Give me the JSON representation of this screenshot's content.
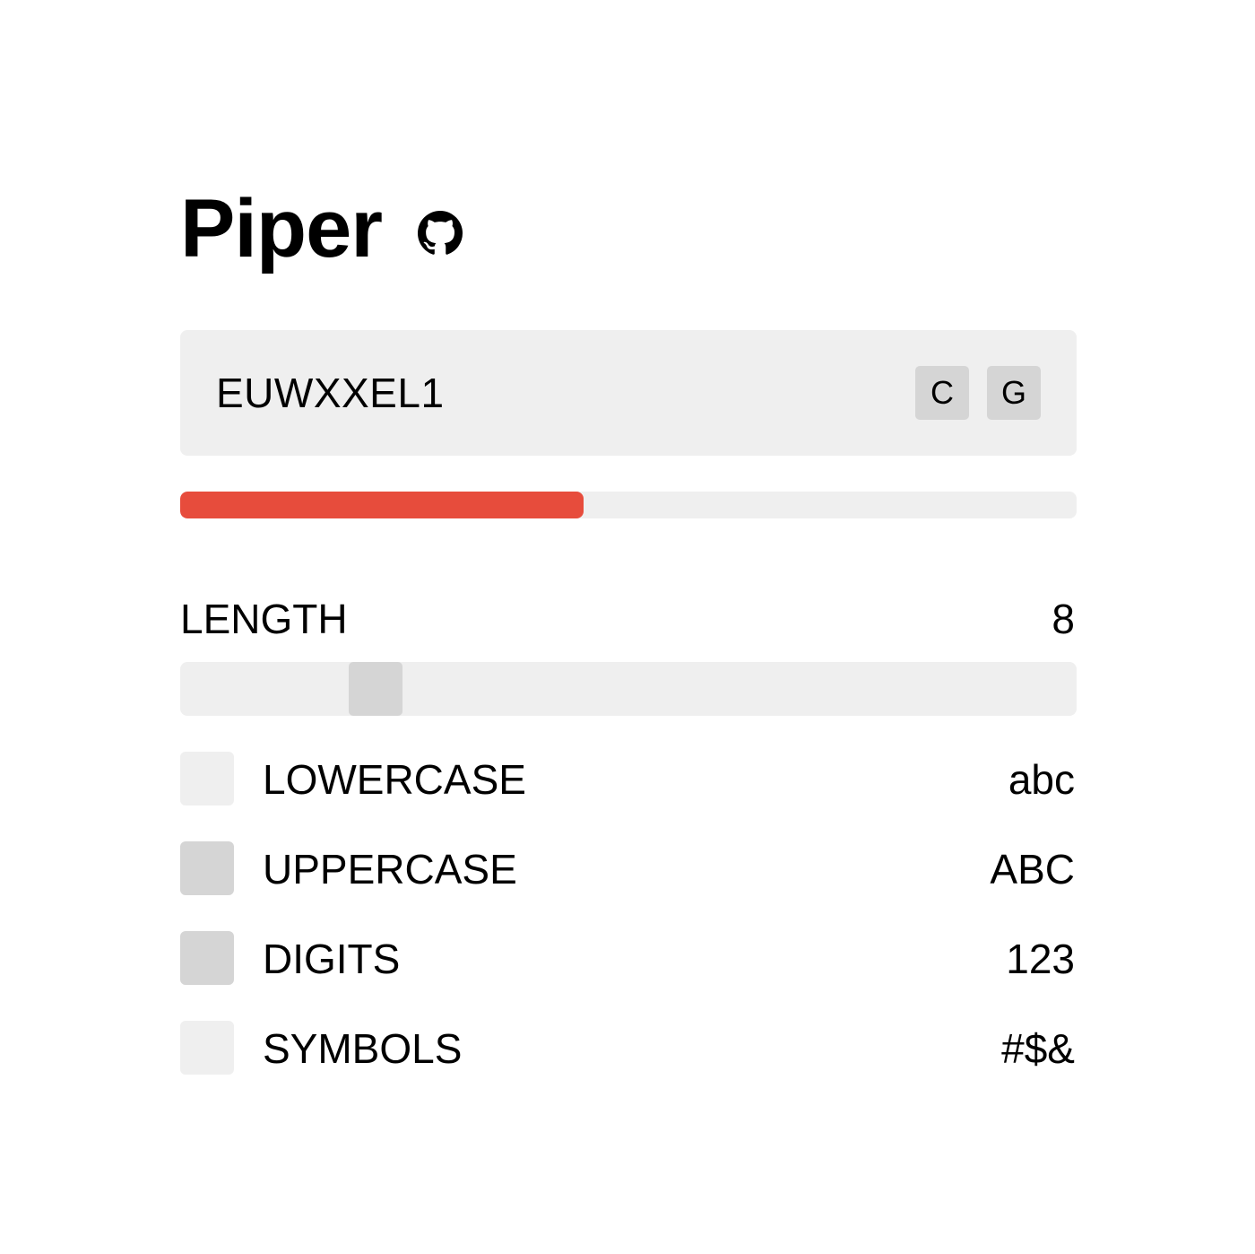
{
  "app": {
    "title": "Piper",
    "github_icon": "github-icon"
  },
  "password": {
    "value": "EUWXXEL1",
    "copy_label": "C",
    "generate_label": "G"
  },
  "strength": {
    "fraction": 0.45,
    "color": "#e74c3c"
  },
  "length": {
    "label": "LENGTH",
    "value": "8",
    "slider_fraction": 0.2
  },
  "options": [
    {
      "label": "LOWERCASE",
      "sample": "abc",
      "checked": false
    },
    {
      "label": "UPPERCASE",
      "sample": "ABC",
      "checked": true
    },
    {
      "label": "DIGITS",
      "sample": "123",
      "checked": true
    },
    {
      "label": "SYMBOLS",
      "sample": "#$&",
      "checked": false
    }
  ]
}
